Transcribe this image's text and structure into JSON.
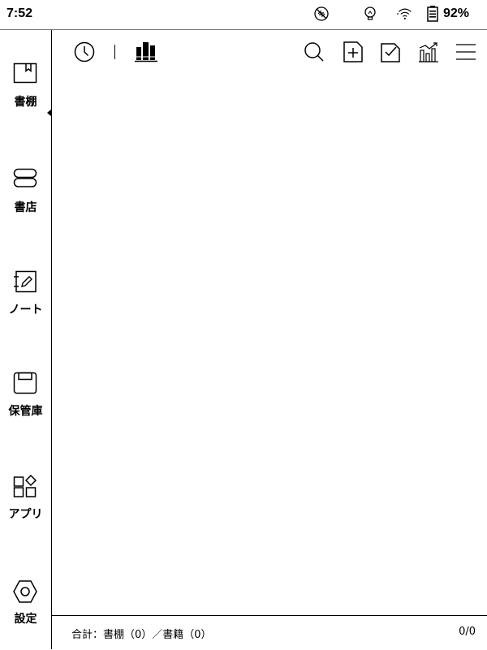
{
  "status_bar": {
    "time": "7:52",
    "battery_percent": "92%",
    "icons": [
      "no-sync-icon",
      "frontlight-icon",
      "wifi-icon",
      "battery-icon"
    ]
  },
  "sidebar": {
    "active_index": 0,
    "items": [
      {
        "label": "書棚",
        "icon": "bookshelf-icon"
      },
      {
        "label": "書店",
        "icon": "bookstore-icon"
      },
      {
        "label": "ノート",
        "icon": "notebook-icon"
      },
      {
        "label": "保管庫",
        "icon": "storage-icon"
      },
      {
        "label": "アプリ",
        "icon": "apps-icon"
      },
      {
        "label": "設定",
        "icon": "settings-icon"
      }
    ]
  },
  "toolbar": {
    "left_icons": [
      "recent-icon",
      "library-icon"
    ],
    "right_icons": [
      "search-icon",
      "new-folder-icon",
      "select-icon",
      "statistics-icon",
      "menu-icon"
    ]
  },
  "footer": {
    "total_text": "合計：書棚（0）／書籍（0）",
    "page_text": "0/0"
  }
}
